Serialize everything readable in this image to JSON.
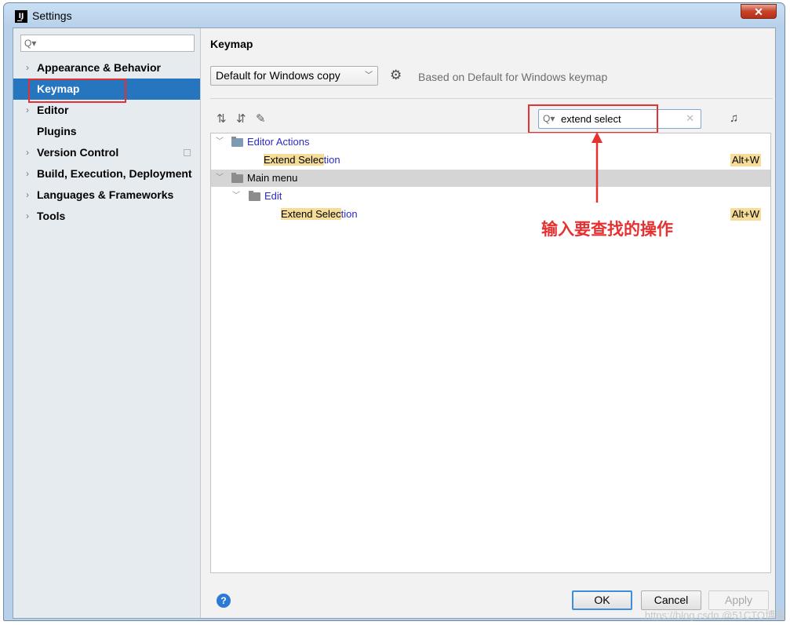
{
  "window": {
    "title": "Settings",
    "app_icon": "IJ",
    "close_glyph": "✕"
  },
  "sidebar": {
    "search_placeholder": "",
    "items": [
      {
        "label": "Appearance & Behavior",
        "expandable": true
      },
      {
        "label": "Keymap",
        "selected": true
      },
      {
        "label": "Editor",
        "expandable": true
      },
      {
        "label": "Plugins"
      },
      {
        "label": "Version Control",
        "expandable": true
      },
      {
        "label": "Build, Execution, Deployment",
        "expandable": true
      },
      {
        "label": "Languages & Frameworks",
        "expandable": true
      },
      {
        "label": "Tools",
        "expandable": true
      }
    ]
  },
  "main": {
    "title": "Keymap",
    "keymap_select": "Default for Windows copy",
    "based_on": "Based on Default for Windows keymap",
    "search": {
      "value": "extend select"
    },
    "tree": {
      "editor_actions": "Editor Actions",
      "extend_1": {
        "a": "Extend",
        "b": " ",
        "c": "Selec",
        "d": "tion"
      },
      "main_menu": "Main menu",
      "edit": "Edit",
      "shortcut": "Alt+W"
    }
  },
  "annotation": "输入要查找的操作",
  "buttons": {
    "ok": "OK",
    "cancel": "Cancel",
    "apply": "Apply",
    "help": "?"
  },
  "watermark": "https://blog.csdn.@51CTO博客",
  "colors": {
    "accent": "#2675bf",
    "annotation": "#e53131",
    "match_highlight": "#f5dc98"
  }
}
